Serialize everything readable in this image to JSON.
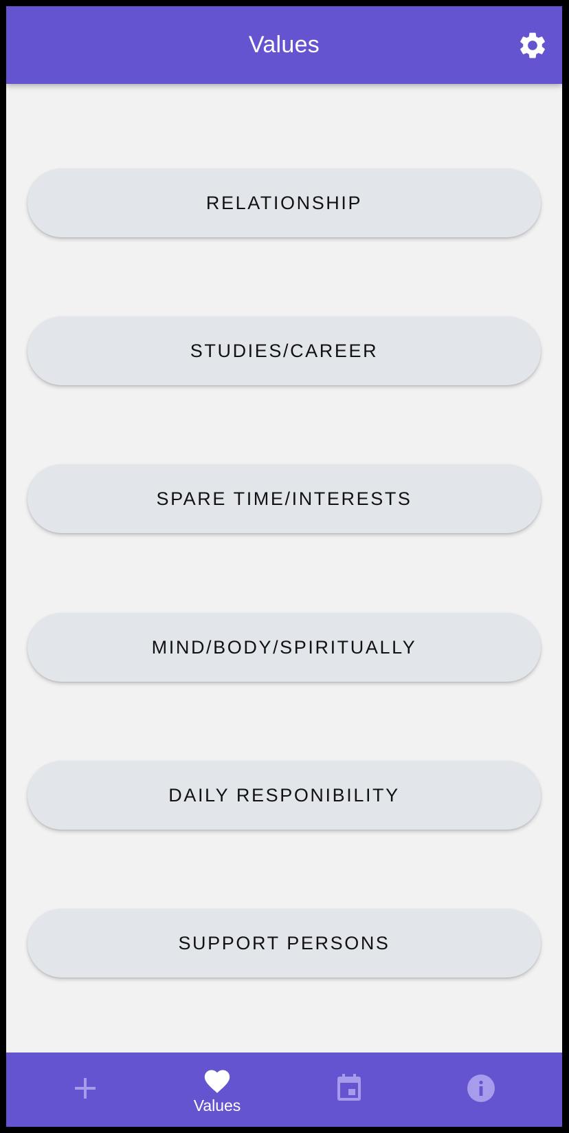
{
  "colors": {
    "primary": "#6554cf",
    "background": "#f2f2f2",
    "button": "#e2e6ea",
    "inactive_icon": "#a79bec",
    "active_icon": "#ffffff"
  },
  "header": {
    "title": "Values",
    "settings_icon": "gear-icon"
  },
  "values": [
    {
      "label": "RELATIONSHIP"
    },
    {
      "label": "STUDIES/CAREER"
    },
    {
      "label": "SPARE TIME/INTERESTS"
    },
    {
      "label": "MIND/BODY/SPIRITUALLY"
    },
    {
      "label": "DAILY RESPONIBILITY"
    },
    {
      "label": "SUPPORT PERSONS"
    }
  ],
  "bottom_nav": {
    "items": [
      {
        "icon": "plus-icon",
        "label": "",
        "active": false
      },
      {
        "icon": "heart-icon",
        "label": "Values",
        "active": true
      },
      {
        "icon": "calendar-icon",
        "label": "",
        "active": false
      },
      {
        "icon": "info-icon",
        "label": "",
        "active": false
      }
    ]
  }
}
